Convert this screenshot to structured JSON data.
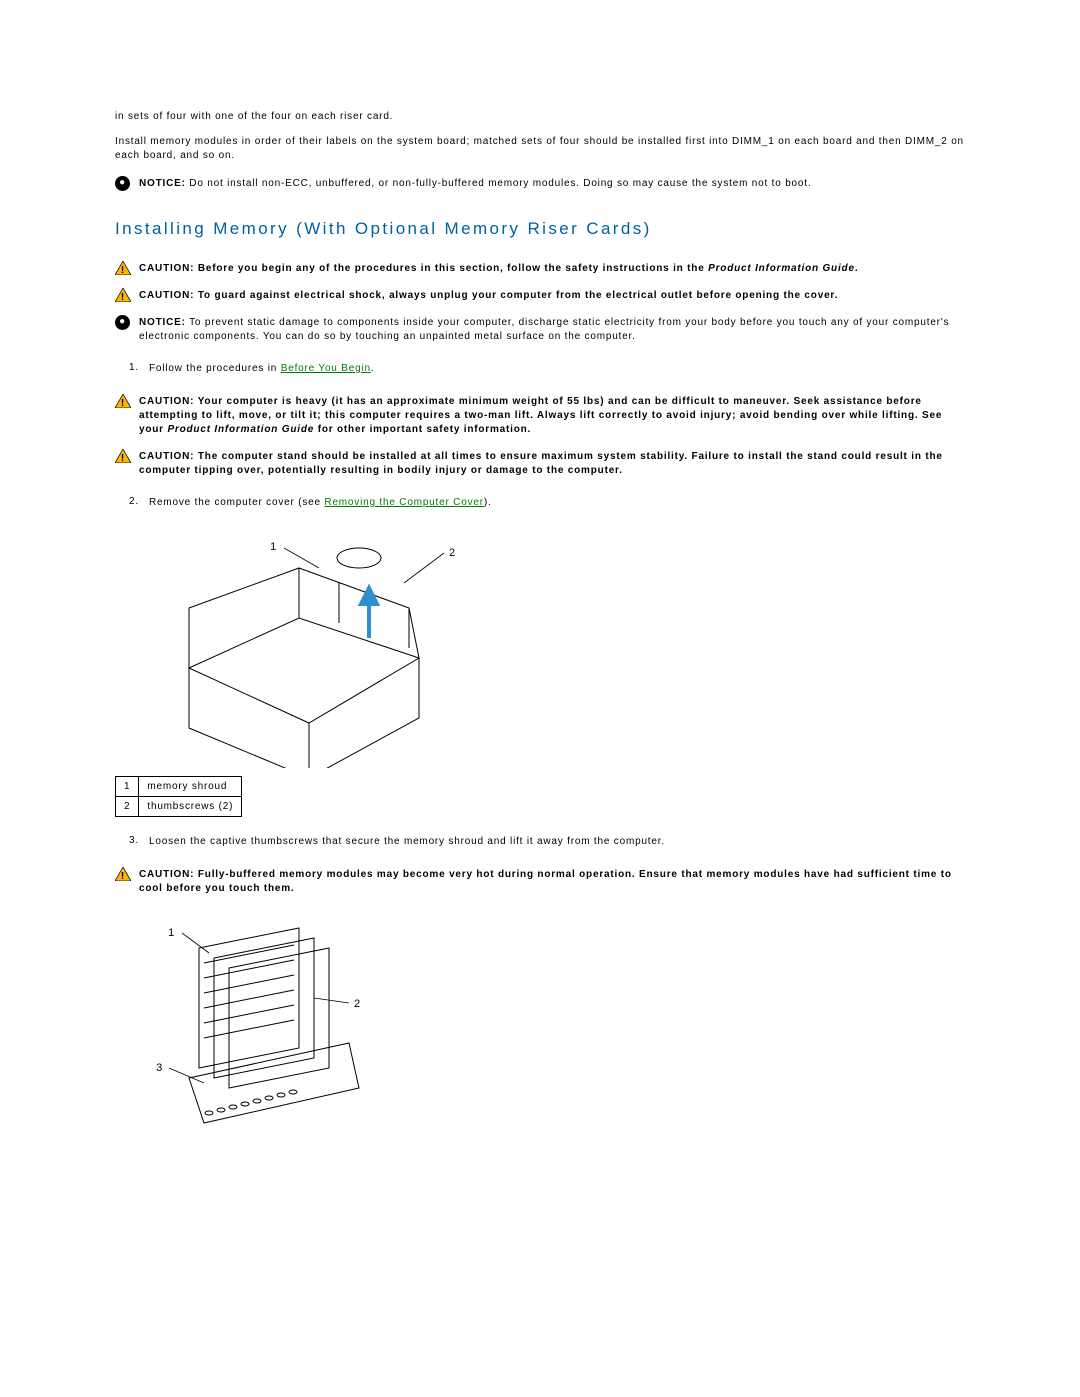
{
  "intro": {
    "line1": "in sets of four with one of the four on each riser card.",
    "line2": "Install memory modules in order of their labels on the system board; matched sets of four should be installed first into DIMM_1 on each board and then DIMM_2 on each board, and so on."
  },
  "notice1": {
    "label": "NOTICE:",
    "text": " Do not install non-ECC, unbuffered, or non-fully-buffered memory modules. Doing so may cause the system not to boot."
  },
  "heading": "Installing Memory (With Optional Memory Riser Cards)",
  "caution1": {
    "label": "CAUTION:",
    "text_a": " Before you begin any of the procedures in this section, follow the safety instructions in the ",
    "em": "Product Information Guide",
    "text_b": "."
  },
  "caution2": {
    "label": "CAUTION:",
    "text": " To guard against electrical shock, always unplug your computer from the electrical outlet before opening the cover."
  },
  "notice2": {
    "label": "NOTICE:",
    "text": " To prevent static damage to components inside your computer, discharge static electricity from your body before you touch any of your computer's electronic components. You can do so by touching an unpainted metal surface on the computer."
  },
  "step1": {
    "num": "1.",
    "text_a": "Follow the procedures in ",
    "link": "Before You Begin",
    "text_b": "."
  },
  "caution3": {
    "label": "CAUTION:",
    "text_a": " Your computer is heavy (it has an approximate minimum weight of 55 lbs) and can be difficult to maneuver. Seek assistance before attempting to lift, move, or tilt it; this computer requires a two-man lift. Always lift correctly to avoid injury; avoid bending over while lifting. See your ",
    "em": "Product Information Guide",
    "text_b": " for other important safety information."
  },
  "caution4": {
    "label": "CAUTION:",
    "text": " The computer stand should be installed at all times to ensure maximum system stability. Failure to install the stand could result in the computer tipping over, potentially resulting in bodily injury or damage to the computer."
  },
  "step2": {
    "num": "2.",
    "text_a": "Remove the computer cover (see ",
    "link": "Removing the Computer Cover",
    "text_b": ")."
  },
  "diagram1": {
    "callout1": "1",
    "callout2": "2",
    "placeholder": "[computer chassis diagram]"
  },
  "legend": {
    "rows": [
      {
        "num": "1",
        "label": "memory shroud"
      },
      {
        "num": "2",
        "label": "thumbscrews (2)"
      }
    ]
  },
  "step3": {
    "num": "3.",
    "text": "Loosen the captive thumbscrews that secure the memory shroud and lift it away from the computer."
  },
  "caution5": {
    "label": "CAUTION:",
    "text": " Fully-buffered memory modules may become very hot during normal operation. Ensure that memory modules have had sufficient time to cool before you touch them."
  },
  "diagram2": {
    "callout1": "1",
    "callout2": "2",
    "callout3": "3",
    "placeholder": "[memory riser cards diagram]"
  }
}
